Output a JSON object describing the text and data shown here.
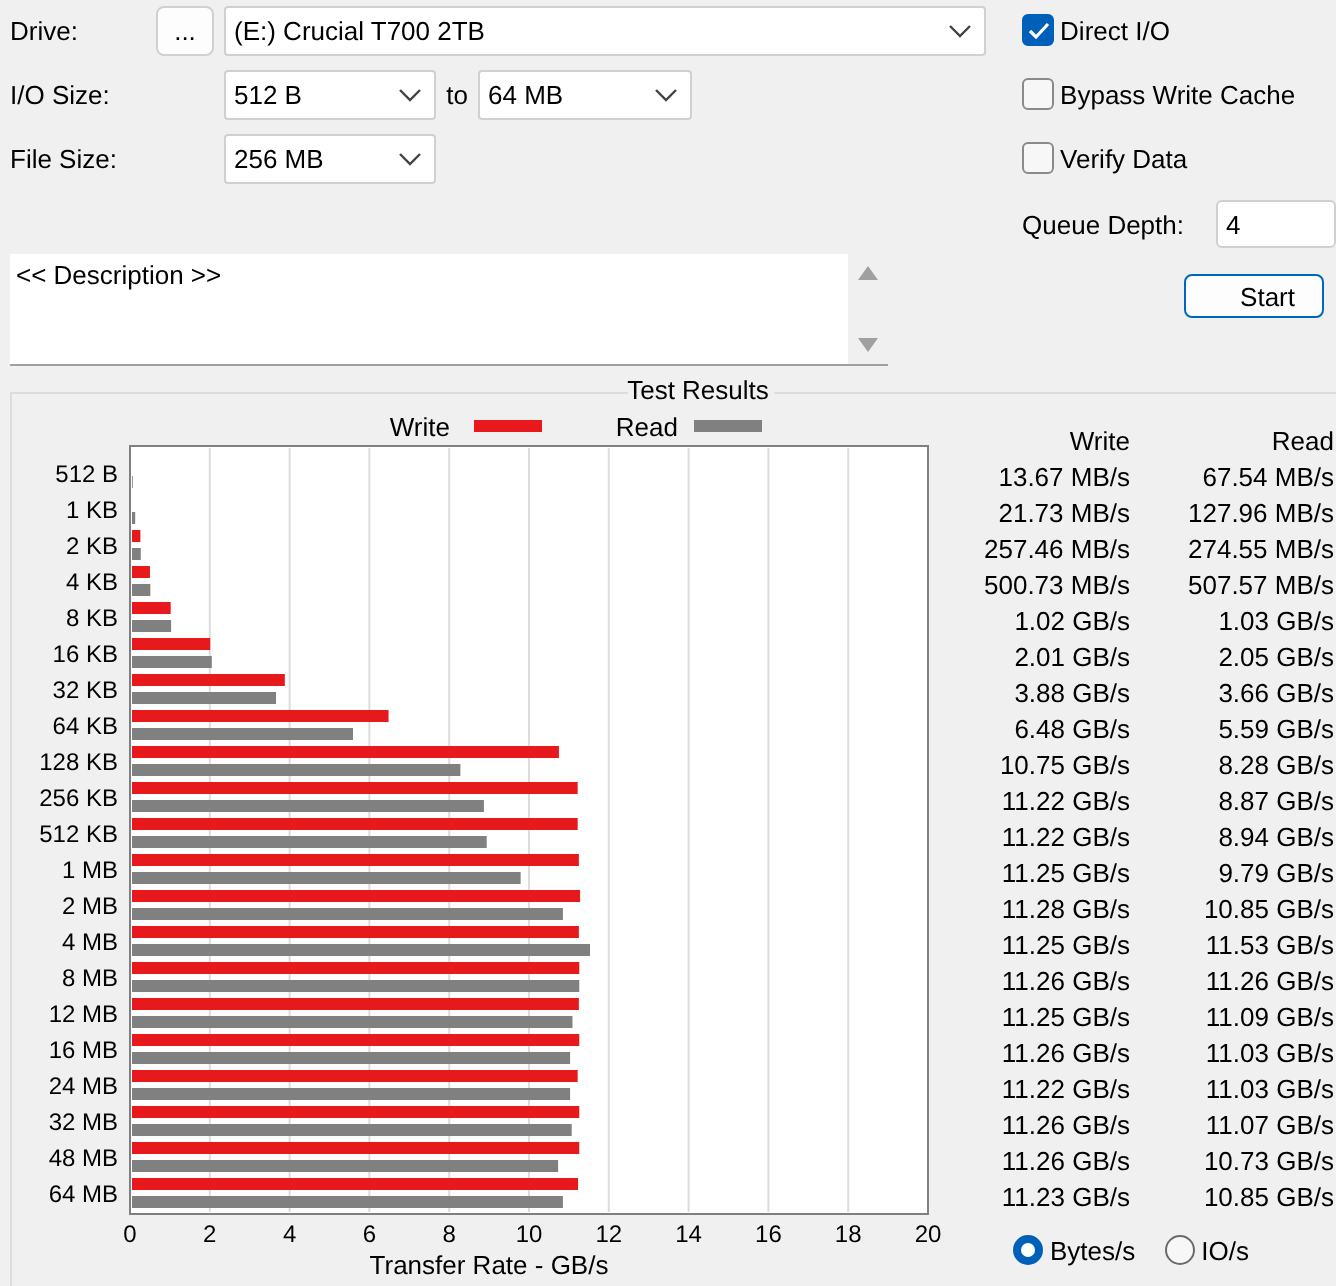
{
  "drive": {
    "label": "Drive:",
    "browse": "...",
    "value": "(E:) Crucial T700 2TB"
  },
  "io_size": {
    "label": "I/O Size:",
    "from": "512 B",
    "to_label": "to",
    "to": "64 MB"
  },
  "file_size": {
    "label": "File Size:",
    "value": "256 MB"
  },
  "options": [
    {
      "label": "Direct I/O",
      "checked": true
    },
    {
      "label": "Bypass Write Cache",
      "checked": false
    },
    {
      "label": "Verify Data",
      "checked": false
    }
  ],
  "queue_depth": {
    "label": "Queue Depth:",
    "value": "4"
  },
  "start_button": "Start",
  "description": {
    "value": "<< Description >>"
  },
  "results": {
    "chart_data": {
      "type": "bar",
      "orientation": "horizontal",
      "title": "Test Results",
      "xlabel": "Transfer Rate - GB/s",
      "categories": [
        "512 B",
        "1 KB",
        "2 KB",
        "4 KB",
        "8 KB",
        "16 KB",
        "32 KB",
        "64 KB",
        "128 KB",
        "256 KB",
        "512 KB",
        "1 MB",
        "2 MB",
        "4 MB",
        "8 MB",
        "12 MB",
        "16 MB",
        "24 MB",
        "32 MB",
        "48 MB",
        "64 MB"
      ],
      "series": [
        {
          "name": "Write",
          "color": "#e8191c",
          "values": [
            0.01,
            0.02,
            0.26,
            0.5,
            1.02,
            2.01,
            3.88,
            6.48,
            10.75,
            11.22,
            11.22,
            11.25,
            11.28,
            11.25,
            11.26,
            11.25,
            11.26,
            11.22,
            11.26,
            11.26,
            11.23
          ]
        },
        {
          "name": "Read",
          "color": "#808080",
          "values": [
            0.07,
            0.13,
            0.27,
            0.51,
            1.03,
            2.05,
            3.66,
            5.59,
            8.28,
            8.87,
            8.94,
            9.79,
            10.85,
            11.53,
            11.26,
            11.09,
            11.03,
            11.03,
            11.07,
            10.73,
            10.85
          ]
        }
      ],
      "xlim": [
        0,
        20
      ],
      "grid": true,
      "legend": true,
      "xticks": [
        0,
        2,
        4,
        6,
        8,
        10,
        12,
        14,
        16,
        18,
        20
      ]
    },
    "columns": [
      "Write",
      "Read"
    ],
    "rows": [
      {
        "write": "13.67 MB/s",
        "read": "67.54 MB/s"
      },
      {
        "write": "21.73 MB/s",
        "read": "127.96 MB/s"
      },
      {
        "write": "257.46 MB/s",
        "read": "274.55 MB/s"
      },
      {
        "write": "500.73 MB/s",
        "read": "507.57 MB/s"
      },
      {
        "write": "1.02 GB/s",
        "read": "1.03 GB/s"
      },
      {
        "write": "2.01 GB/s",
        "read": "2.05 GB/s"
      },
      {
        "write": "3.88 GB/s",
        "read": "3.66 GB/s"
      },
      {
        "write": "6.48 GB/s",
        "read": "5.59 GB/s"
      },
      {
        "write": "10.75 GB/s",
        "read": "8.28 GB/s"
      },
      {
        "write": "11.22 GB/s",
        "read": "8.87 GB/s"
      },
      {
        "write": "11.22 GB/s",
        "read": "8.94 GB/s"
      },
      {
        "write": "11.25 GB/s",
        "read": "9.79 GB/s"
      },
      {
        "write": "11.28 GB/s",
        "read": "10.85 GB/s"
      },
      {
        "write": "11.25 GB/s",
        "read": "11.53 GB/s"
      },
      {
        "write": "11.26 GB/s",
        "read": "11.26 GB/s"
      },
      {
        "write": "11.25 GB/s",
        "read": "11.09 GB/s"
      },
      {
        "write": "11.26 GB/s",
        "read": "11.03 GB/s"
      },
      {
        "write": "11.22 GB/s",
        "read": "11.03 GB/s"
      },
      {
        "write": "11.26 GB/s",
        "read": "11.07 GB/s"
      },
      {
        "write": "11.26 GB/s",
        "read": "10.73 GB/s"
      },
      {
        "write": "11.23 GB/s",
        "read": "10.85 GB/s"
      }
    ]
  },
  "units": [
    {
      "label": "Bytes/s",
      "selected": true
    },
    {
      "label": "IO/s",
      "selected": false
    }
  ]
}
